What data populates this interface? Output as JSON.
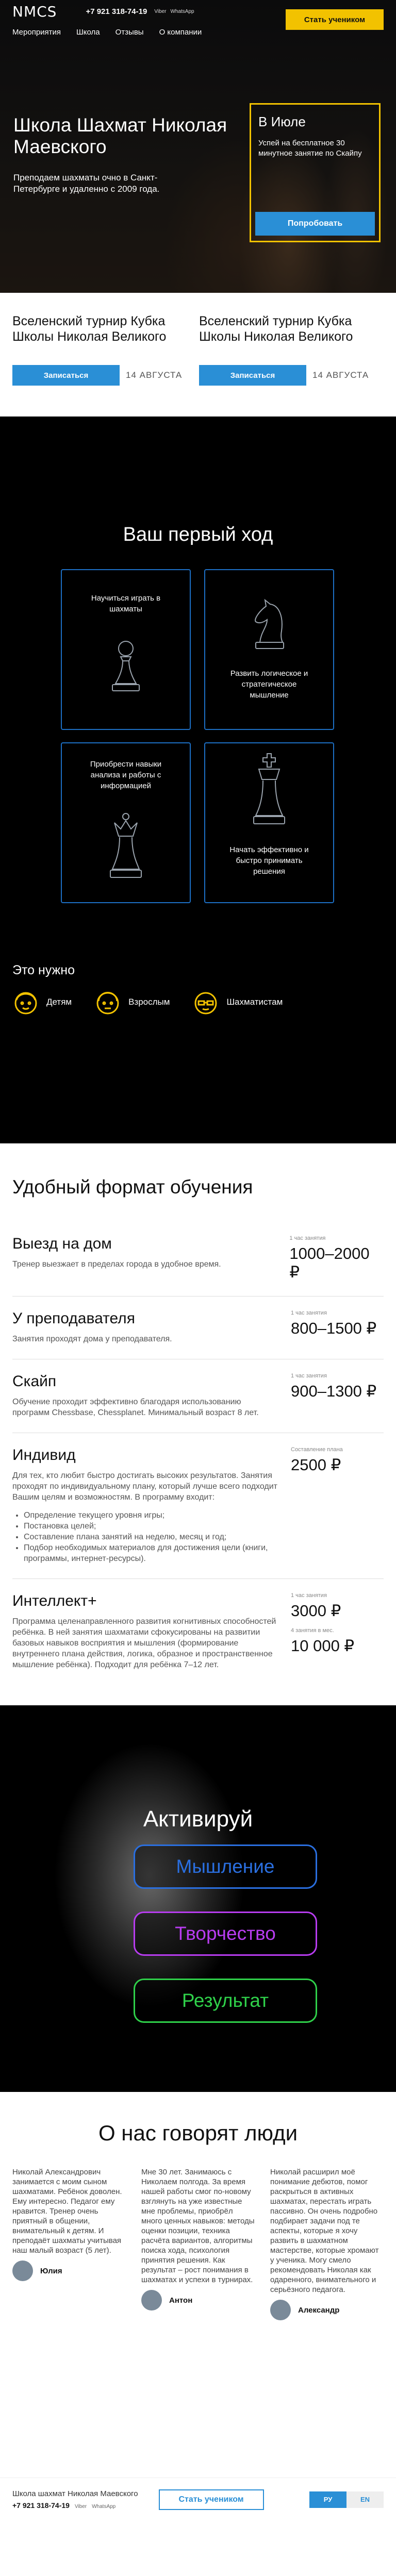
{
  "header": {
    "logo": "NMCS",
    "phone": "+7 921 318-74-19",
    "viber": "Viber",
    "whatsapp": "WhatsApp",
    "cta": "Стать учеником",
    "nav": [
      "Мероприятия",
      "Школа",
      "Отзывы",
      "О компании"
    ]
  },
  "hero": {
    "title": "Школа Шахмат Николая Маевского",
    "subtitle": "Преподаем шахматы очно в Санкт-Петербурге и удаленно с 2009 года.",
    "promo": {
      "title": "В Июле",
      "text": "Успей на бесплатное 30 минутное занятие по Скайпу",
      "button": "Попробовать"
    }
  },
  "tournaments": [
    {
      "title": "Вселенский турнир Кубка Школы Николая Великого",
      "button": "Записаться",
      "date": "14 АВГУСТА"
    },
    {
      "title": "Вселенский турнир Кубка Школы Николая Великого",
      "button": "Записаться",
      "date": "14 АВГУСТА"
    }
  ],
  "first_move": {
    "title": "Ваш первый ход",
    "cards": [
      {
        "label": "Научиться играть в шахматы",
        "icon": "pawn-icon"
      },
      {
        "label": "Развить логическое и стратегическое мышление",
        "icon": "knight-icon"
      },
      {
        "label": "Приобрести навыки анализа и работы с информацией",
        "icon": "queen-icon"
      },
      {
        "label": "Начать эффективно и быстро принимать решения",
        "icon": "king-icon"
      }
    ],
    "audience_title": "Это нужно",
    "audience": [
      {
        "label": "Детям",
        "icon": "child-face-icon"
      },
      {
        "label": "Взрослым",
        "icon": "adult-face-icon"
      },
      {
        "label": "Шахматистам",
        "icon": "chessplayer-face-icon"
      }
    ],
    "accent": "#f2c200",
    "card_border": "#1d6fc4"
  },
  "formats": {
    "title": "Удобный формат обучения",
    "items": [
      {
        "name": "Выезд на дом",
        "desc": "Тренер выезжает в пределах города в удобное время.",
        "cap": "1 час занятия",
        "price": "1000–2000 ₽"
      },
      {
        "name": "У преподавателя",
        "desc": "Занятия проходят дома у преподавателя.",
        "cap": "1 час занятия",
        "price": "800–1500 ₽"
      },
      {
        "name": "Скайп",
        "desc": "Обучение проходит эффективно благодаря использованию программ Chessbase, Chessplanet. Минимальный возраст 8 лет.",
        "cap": "1 час занятия",
        "price": "900–1300 ₽"
      },
      {
        "name": "Индивид",
        "desc": "Для тех, кто любит быстро достигать высоких результатов. Занятия проходят по индивидуальному плану, который лучше всего подходит Вашим целям и возможностям. В программу входит:",
        "list": [
          "Определение текущего уровня игры;",
          "Постановка целей;",
          "Составление плана занятий на неделю, месяц и год;",
          "Подбор необходимых материалов для достижения цели (книги, программы, интернет-ресурсы)."
        ],
        "cap": "Составление плана",
        "price": "2500 ₽"
      },
      {
        "name": "Интеллект+",
        "desc": "Программа целенаправленного развития когнитивных способностей ребёнка. В ней занятия шахматами сфокусированы на развитии базовых навыков восприятия и мышления (формирование внутреннего плана действия, логика, образное и пространственное мышление ребёнка). Подходит для ребёнка 7–12 лет.",
        "cap": "1 час занятия",
        "price": "3000 ₽",
        "cap2": "4 занятия в мес.",
        "price2": "10 000 ₽"
      }
    ]
  },
  "activate": {
    "title": "Активируй",
    "pills": [
      {
        "label": "Мышление",
        "color": "#2a6fe0"
      },
      {
        "label": "Творчество",
        "color": "#b83cf0"
      },
      {
        "label": "Результат",
        "color": "#2fd14a"
      }
    ]
  },
  "reviews": {
    "title": "О нас говорят люди",
    "items": [
      {
        "text": "Николай Александрович занимается с моим сыном шахматами. Ребёнок доволен. Ему интересно. Педагог ему нравится. Тренер очень приятный в общении, внимательный к детям. И преподаёт шахматы учитывая наш малый возраст (5 лет).",
        "author": "Юлия"
      },
      {
        "text": "Мне 30 лет. Занимаюсь с Николаем полгода. За время нашей работы смог по-новому взглянуть на уже известные мне проблемы, приобрёл много ценных навыков: методы оценки позиции, техника расчёта вариантов, алгоритмы поиска хода, психология принятия решения. Как результат – рост понимания в шахматах и успехи в турнирах.",
        "author": "Антон"
      },
      {
        "text": "Николай расширил моё понимание дебютов, помог раскрыться в активных шахматах, перестать играть пассивно. Он очень подробно подбирает задачи под те аспекты, которые я хочу развить в шахматном мастерстве, которые хромают у ученика. Могу смело рекомендовать Николая как одаренного, внимательного и серьёзного педагога.",
        "author": "Александр"
      }
    ]
  },
  "footer": {
    "name": "Школа шахмат Николая Маевского",
    "phone": "+7 921 318-74-19",
    "viber": "Viber",
    "whatsapp": "WhatsApp",
    "cta": "Стать учеником",
    "lang_ru": "РУ",
    "lang_en": "EN"
  }
}
